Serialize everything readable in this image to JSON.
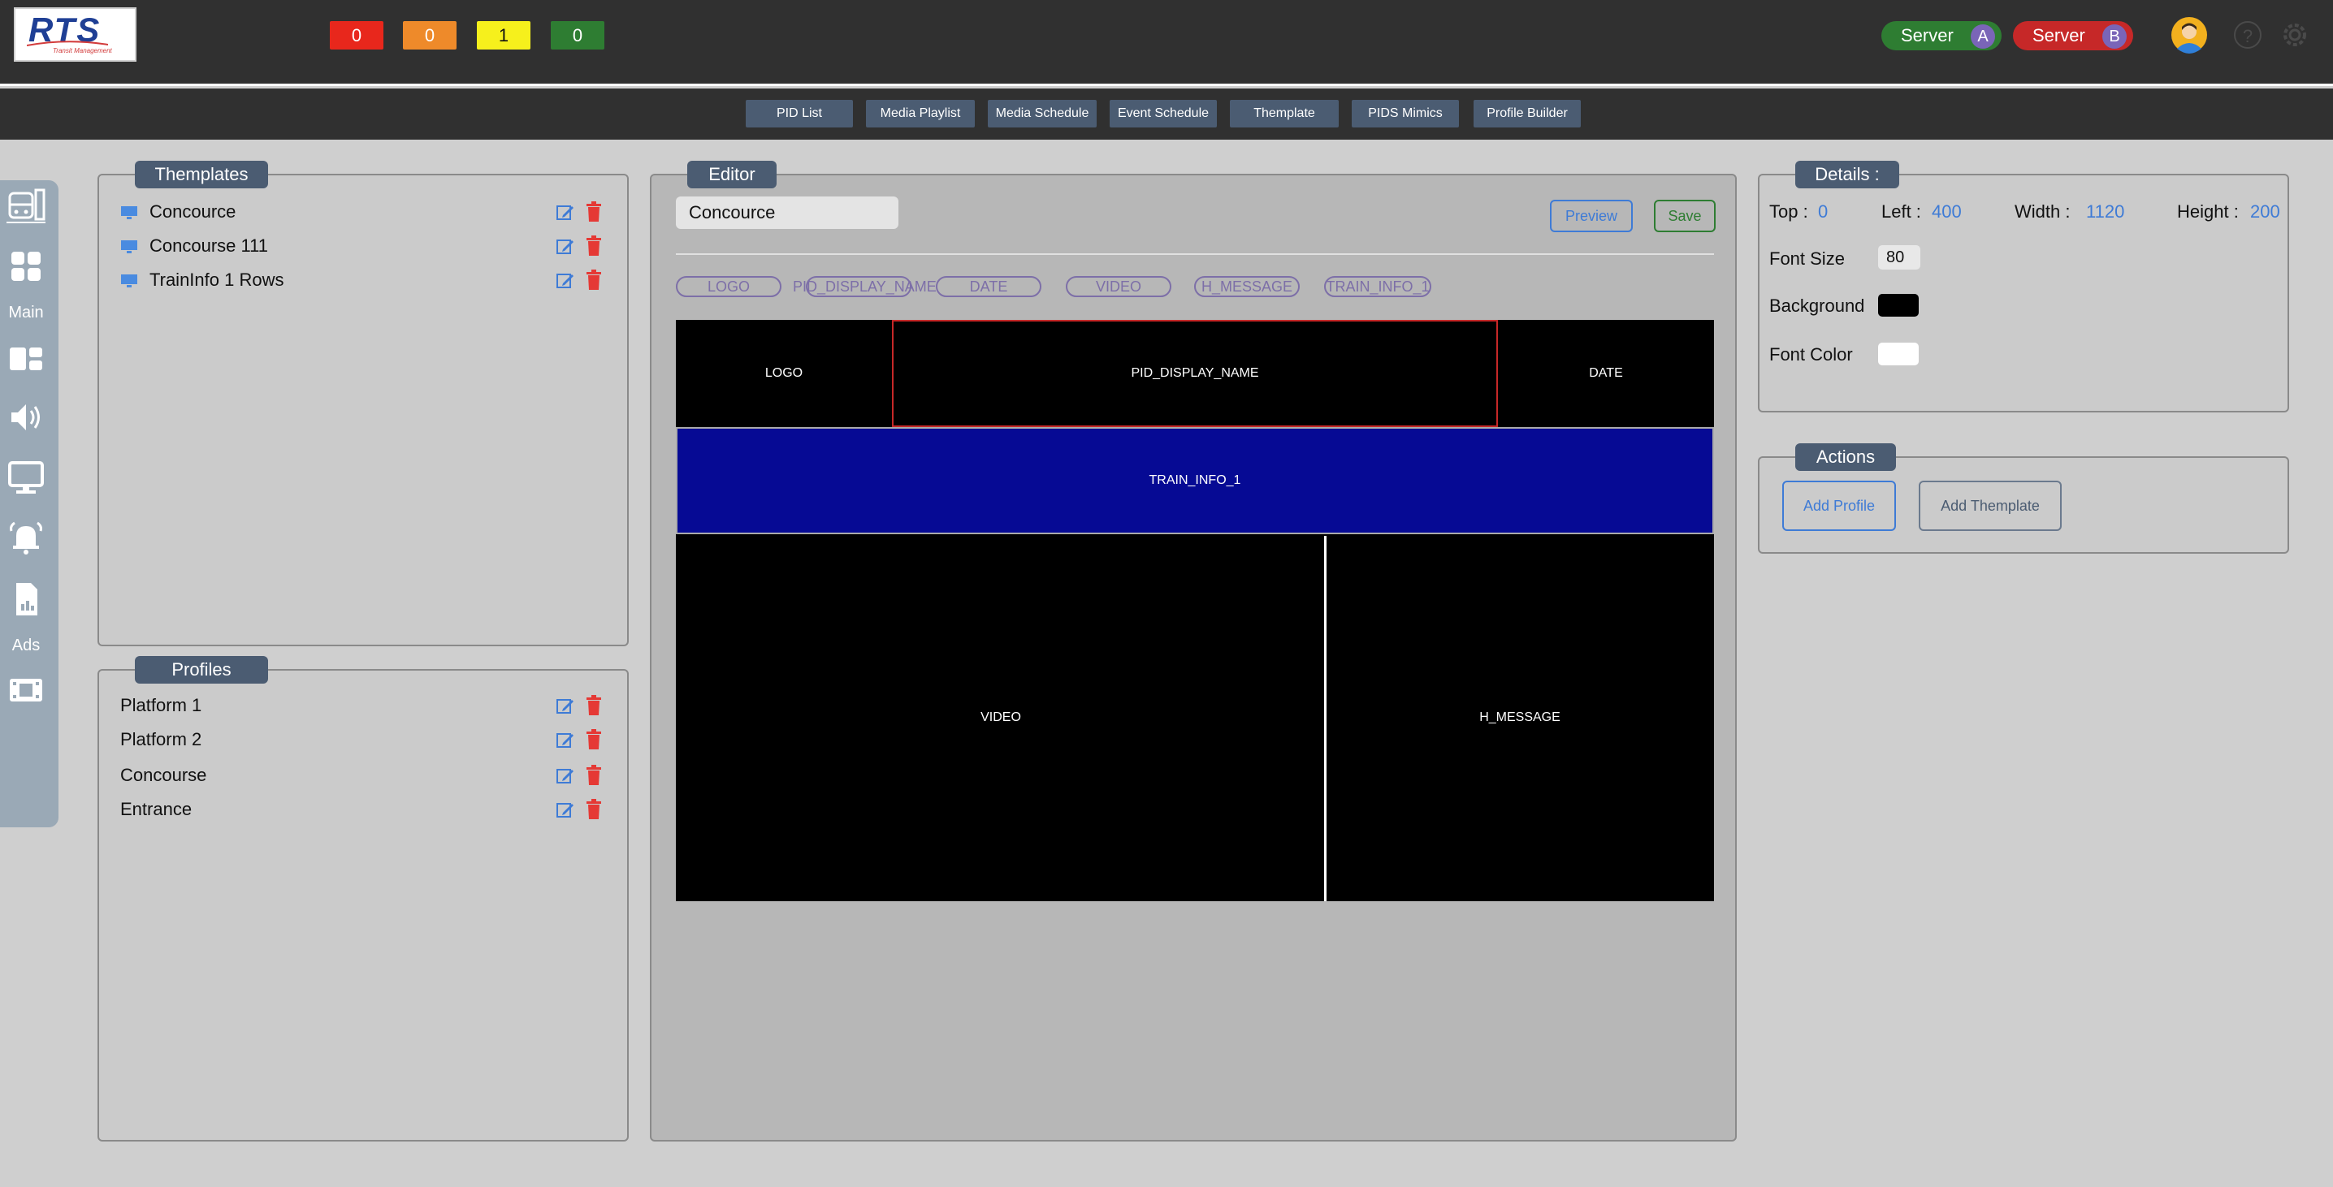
{
  "header": {
    "logo": {
      "text": "RTS",
      "tagline": "Transit Management"
    },
    "counters": [
      {
        "value": "0",
        "color": "#e8271c"
      },
      {
        "value": "0",
        "color": "#ee8a2a"
      },
      {
        "value": "1",
        "color": "#f6f01c"
      },
      {
        "value": "0",
        "color": "#2e7d32"
      }
    ],
    "servers": [
      {
        "label": "Server",
        "letter": "A",
        "color": "#2e7d32"
      },
      {
        "label": "Server",
        "letter": "B",
        "color": "#c62828"
      }
    ],
    "help_symbol": "?"
  },
  "nav": {
    "tabs": [
      "PID List",
      "Media Playlist",
      "Media Schedule",
      "Event Schedule",
      "Themplate",
      "PIDS Mimics",
      "Profile Builder"
    ]
  },
  "side_rail": {
    "labels": {
      "main": "Main",
      "ads": "Ads"
    }
  },
  "templates_panel": {
    "title": "Themplates",
    "items": [
      "Concource",
      "Concourse 111",
      "TrainInfo 1 Rows"
    ]
  },
  "profiles_panel": {
    "title": "Profiles",
    "items": [
      "Platform 1",
      "Platform 2",
      "Concourse",
      "Entrance"
    ]
  },
  "editor": {
    "title": "Editor",
    "name_value": "Concource",
    "preview_label": "Preview",
    "save_label": "Save",
    "chips": [
      "LOGO",
      "PID_DISPLAY_NAME",
      "DATE",
      "VIDEO",
      "H_MESSAGE",
      "TRAIN_INFO_1"
    ],
    "blocks": {
      "logo": "LOGO",
      "pid_display_name": "PID_DISPLAY_NAME",
      "date": "DATE",
      "train_info": "TRAIN_INFO_1",
      "video": "VIDEO",
      "h_message": "H_MESSAGE"
    },
    "colors": {
      "train_info_bg": "#060a94",
      "selected_border": "#c62828"
    }
  },
  "details": {
    "title": "Details :",
    "top_label": "Top :",
    "top_value": "0",
    "left_label": "Left :",
    "left_value": "400",
    "width_label": "Width :",
    "width_value": "1120",
    "height_label": "Height :",
    "height_value": "200",
    "font_size_label": "Font Size",
    "font_size_value": "80",
    "background_label": "Background",
    "background_color": "#000000",
    "font_color_label": "Font Color",
    "font_color": "#ffffff"
  },
  "actions": {
    "title": "Actions",
    "add_profile": "Add Profile",
    "add_template": "Add Themplate"
  }
}
